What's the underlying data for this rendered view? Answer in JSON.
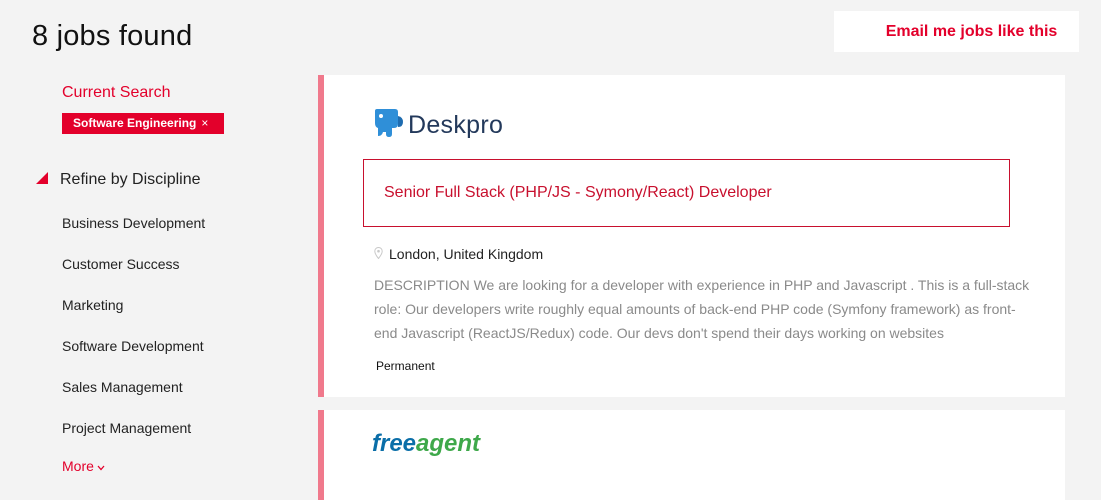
{
  "header": {
    "results_title": "8 jobs found",
    "email_button": "Email me jobs like this"
  },
  "sidebar": {
    "current_search_label": "Current Search",
    "active_filter": {
      "label": "Software Engineering",
      "remove_glyph": "×"
    },
    "refine_heading": "Refine by Discipline",
    "disciplines": [
      "Business Development",
      "Customer Success",
      "Marketing",
      "Software Development",
      "Sales Management",
      "Project Management"
    ],
    "more_label": "More",
    "more_glyph": "⌄"
  },
  "jobs": [
    {
      "company_logo": "Deskpro",
      "logo_icon": "deskpro-elephant-icon",
      "title": "Senior Full Stack (PHP/JS - Symony/React) Developer",
      "location": "London, United Kingdom",
      "description": "DESCRIPTION We are looking for a developer with experience  in PHP and Javascript . This is a full-stack role: Our developers write roughly equal amounts of back-end PHP code (Symfony framework) as front-end Javascript (ReactJS/Redux) code. Our devs don't spend their days working on websites",
      "job_type": "Permanent"
    },
    {
      "company_logo_part1": "free",
      "company_logo_part2": "agent"
    }
  ],
  "colors": {
    "accent": "#e3002b",
    "card_border": "#f0798c",
    "job_title": "#c8102e",
    "deskpro_blue": "#23395b",
    "freeagent_blue": "#0a6ea8",
    "freeagent_green": "#3ea84a"
  }
}
